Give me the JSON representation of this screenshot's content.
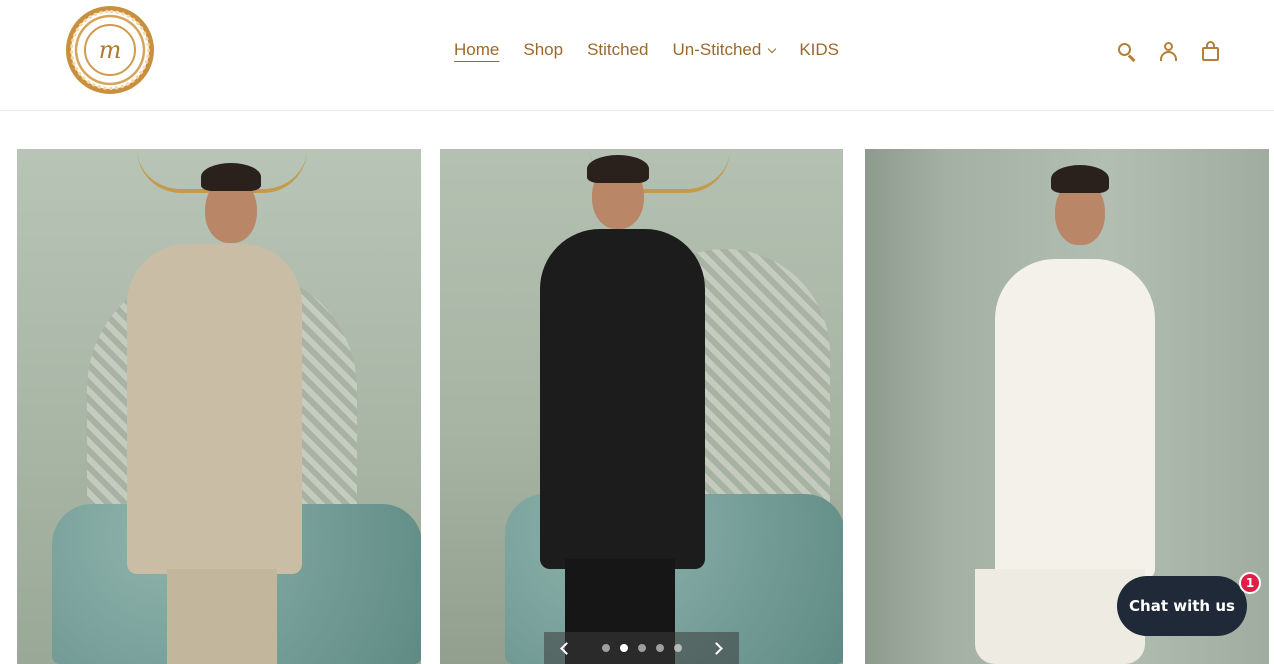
{
  "brand": {
    "logo_letter": "m"
  },
  "nav": {
    "items": [
      {
        "label": "Home"
      },
      {
        "label": "Shop"
      },
      {
        "label": "Stitched"
      },
      {
        "label": "Un-Stitched"
      },
      {
        "label": "KIDS"
      }
    ]
  },
  "header_icons": [
    "search-icon",
    "account-icon",
    "cart-icon"
  ],
  "carousel": {
    "slides": [
      {
        "outfit": "beige kurta shalwar"
      },
      {
        "outfit": "black kurta shalwar"
      },
      {
        "outfit": "white kurta shalwar"
      }
    ],
    "dot_count": 5,
    "active_dot": 2
  },
  "chat": {
    "label": "Chat with us",
    "badge": "1"
  },
  "colors": {
    "accent": "#9a6a2c",
    "chat_bg": "#1f2937",
    "badge": "#e11d48"
  }
}
